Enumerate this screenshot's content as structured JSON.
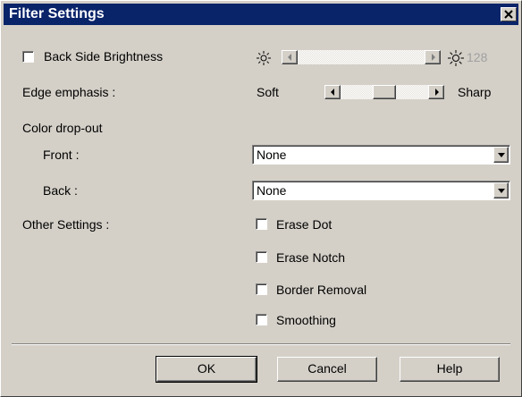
{
  "window": {
    "title": "Filter Settings"
  },
  "brightness": {
    "label": "Back Side Brightness",
    "value": "128",
    "checked": false
  },
  "edge": {
    "label": "Edge emphasis :",
    "min_label": "Soft",
    "max_label": "Sharp"
  },
  "color_dropout": {
    "label": "Color drop-out",
    "front": {
      "label": "Front :",
      "value": "None"
    },
    "back": {
      "label": "Back :",
      "value": "None"
    }
  },
  "other": {
    "label": "Other Settings :",
    "options": [
      {
        "label": "Erase Dot",
        "checked": false
      },
      {
        "label": "Erase Notch",
        "checked": false
      },
      {
        "label": "Border Removal",
        "checked": false
      },
      {
        "label": "Smoothing",
        "checked": false
      }
    ]
  },
  "buttons": {
    "ok": "OK",
    "cancel": "Cancel",
    "help": "Help"
  },
  "icons": {
    "close": "close-icon",
    "sun": "sun-icon",
    "scroll_left": "arrow-left-icon",
    "scroll_right": "arrow-right-icon",
    "dropdown": "chevron-down-icon"
  }
}
